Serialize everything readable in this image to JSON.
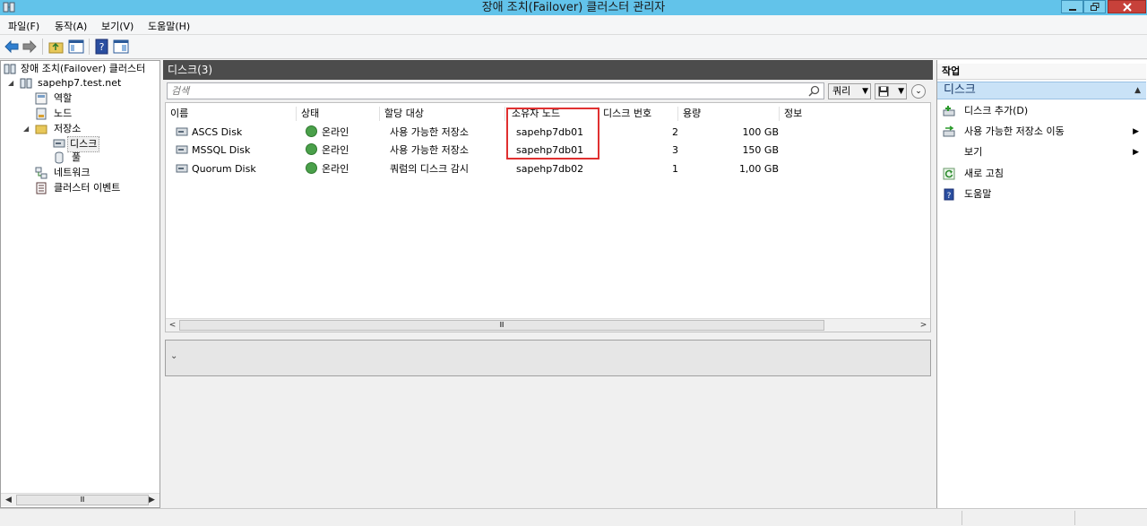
{
  "window": {
    "title": "장애 조치(Failover) 클러스터 관리자"
  },
  "menu": [
    "파일(F)",
    "동작(A)",
    "보기(V)",
    "도움말(H)"
  ],
  "tree": {
    "root": "장애 조치(Failover) 클러스터",
    "cluster": "sapehp7.test.net",
    "roles": "역할",
    "nodes": "노드",
    "storage": "저장소",
    "disks": "디스크",
    "pools": "풀",
    "networks": "네트워크",
    "events": "클러스터 이벤트"
  },
  "center": {
    "header": "디스크(3)",
    "search_placeholder": "검색",
    "query_label": "쿼리",
    "columns": [
      "이름",
      "상태",
      "할당 대상",
      "소유자 노드",
      "디스크 번호",
      "용량",
      "정보"
    ],
    "rows": [
      {
        "name": "ASCS Disk",
        "status": "온라인",
        "assigned": "사용 가능한 저장소",
        "owner": "sapehp7db01",
        "disk_no": "2",
        "capacity": "100 GB",
        "info": ""
      },
      {
        "name": "MSSQL Disk",
        "status": "온라인",
        "assigned": "사용 가능한 저장소",
        "owner": "sapehp7db01",
        "disk_no": "3",
        "capacity": "150 GB",
        "info": ""
      },
      {
        "name": "Quorum Disk",
        "status": "온라인",
        "assigned": "쿼럼의 디스크 감시",
        "owner": "sapehp7db02",
        "disk_no": "1",
        "capacity": "1,00 GB",
        "info": ""
      }
    ],
    "scroll_thumb": "Ⅲ"
  },
  "actions": {
    "header": "작업",
    "section": "디스크",
    "items": [
      {
        "label": "디스크 추가(D)",
        "icon": "add-disk-icon",
        "submenu": false
      },
      {
        "label": "사용 가능한 저장소 이동",
        "icon": "move-storage-icon",
        "submenu": true
      },
      {
        "label": "보기",
        "icon": "",
        "submenu": true
      },
      {
        "label": "새로 고침",
        "icon": "refresh-icon",
        "submenu": false
      },
      {
        "label": "도움말",
        "icon": "help-icon",
        "submenu": false
      }
    ]
  },
  "colors": {
    "titlebar": "#62c3ea",
    "header_dark": "#4c4c4c",
    "selection_blue": "#c9e2f7",
    "highlight_red": "#e03030",
    "online_green": "#4aa04a"
  }
}
